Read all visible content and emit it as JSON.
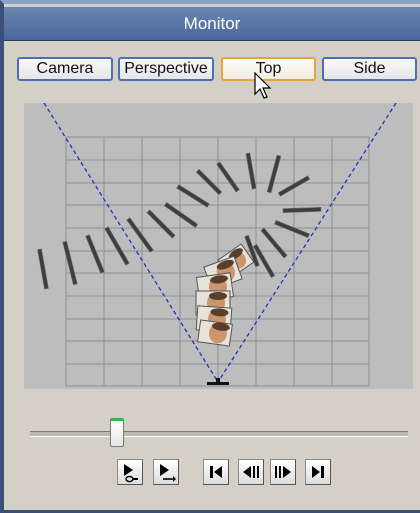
{
  "window": {
    "title": "Monitor"
  },
  "view_buttons": [
    {
      "label": "Camera",
      "active": false
    },
    {
      "label": "Perspective",
      "active": false
    },
    {
      "label": "Top",
      "active": true
    },
    {
      "label": "Side",
      "active": false
    }
  ],
  "viewport": {
    "background_color": "#bdbdbd",
    "grid_color": "#8e8e8e",
    "frustum_line_color": "#1e32c8",
    "content": "top view of camera frustum over a grid with an arc of card objects and face images"
  },
  "timeline_slider": {
    "position_fraction": 0.23
  },
  "playback_controls": [
    {
      "icon": "play-loop-icon"
    },
    {
      "icon": "play-forward-icon"
    },
    {
      "icon": "skip-to-start-icon"
    },
    {
      "icon": "step-back-icon"
    },
    {
      "icon": "step-forward-icon"
    },
    {
      "icon": "skip-to-end-icon"
    }
  ],
  "colors": {
    "title_bar": "#5a74a6",
    "active_button_border": "#e8a436",
    "button_border": "#4e6fb8",
    "panel": "#d4d0c8"
  }
}
